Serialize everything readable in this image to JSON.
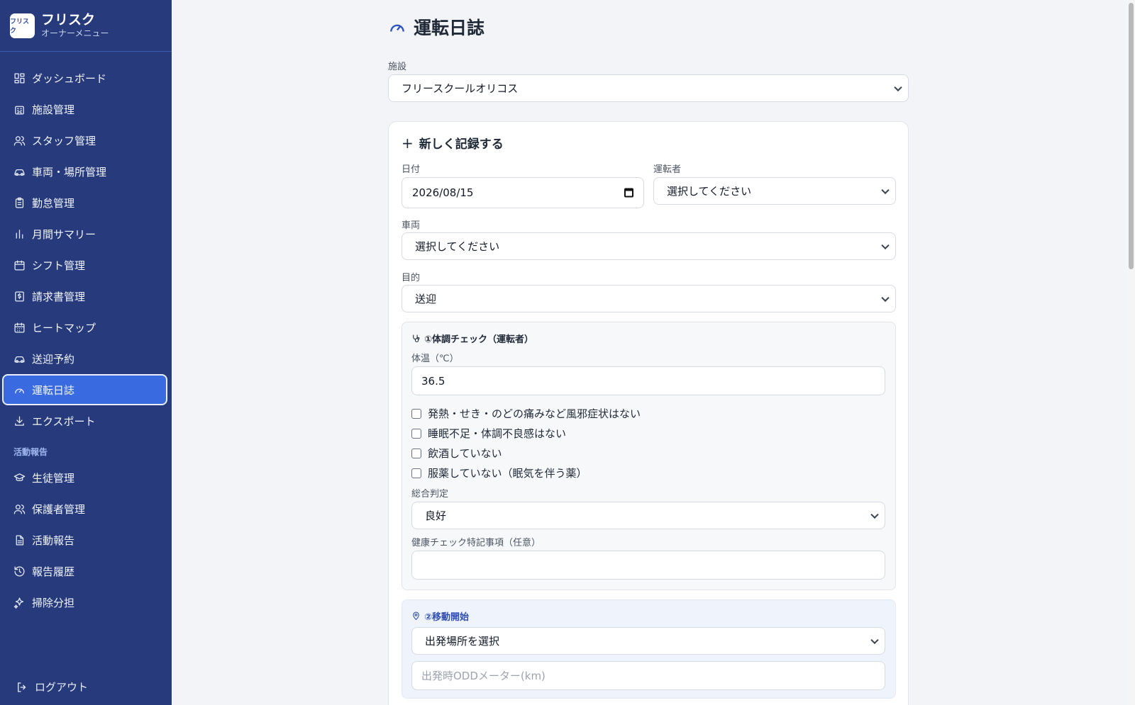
{
  "sidebar": {
    "brand": {
      "logo_text": "フリスク",
      "title": "フリスク",
      "subtitle": "オーナーメニュー"
    },
    "items": [
      {
        "label": "ダッシュボード",
        "icon": "dashboard-icon"
      },
      {
        "label": "施設管理",
        "icon": "building-icon"
      },
      {
        "label": "スタッフ管理",
        "icon": "users-icon"
      },
      {
        "label": "車両・場所管理",
        "icon": "car-icon"
      },
      {
        "label": "勤怠管理",
        "icon": "clipboard-icon"
      },
      {
        "label": "月間サマリー",
        "icon": "bar-chart-icon"
      },
      {
        "label": "シフト管理",
        "icon": "calendar-icon"
      },
      {
        "label": "請求書管理",
        "icon": "invoice-icon"
      },
      {
        "label": "ヒートマップ",
        "icon": "calendar-grid-icon"
      },
      {
        "label": "送迎予約",
        "icon": "car-icon"
      },
      {
        "label": "運転日誌",
        "icon": "gauge-icon",
        "active": true
      },
      {
        "label": "エクスポート",
        "icon": "download-icon"
      }
    ],
    "section_label": "活動報告",
    "section_items": [
      {
        "label": "生徒管理",
        "icon": "graduation-cap-icon"
      },
      {
        "label": "保護者管理",
        "icon": "users-icon"
      },
      {
        "label": "活動報告",
        "icon": "document-icon"
      },
      {
        "label": "報告履歴",
        "icon": "history-icon"
      },
      {
        "label": "掃除分担",
        "icon": "sparkles-icon"
      }
    ],
    "logout_label": "ログアウト"
  },
  "main": {
    "title": "運転日誌",
    "facility_label": "施設",
    "facility_value": "フリースクールオリコス",
    "form": {
      "title": "新しく記録する",
      "date_label": "日付",
      "date_value": "2026/08/15",
      "driver_label": "運転者",
      "driver_value": "選択してください",
      "vehicle_label": "車両",
      "vehicle_value": "選択してください",
      "purpose_label": "目的",
      "purpose_value": "送迎",
      "health": {
        "title": "①体調チェック（運転者）",
        "temp_label": "体温（℃）",
        "temp_value": "36.5",
        "checks": [
          "発熱・せき・のどの痛みなど風邪症状はない",
          "睡眠不足・体調不良感はない",
          "飲酒していない",
          "服薬していない（眠気を伴う薬）"
        ],
        "overall_label": "総合判定",
        "overall_value": "良好",
        "notes_label": "健康チェック特記事項（任意）",
        "notes_value": ""
      },
      "departure": {
        "title": "②移動開始",
        "place_value": "出発場所を選択",
        "odometer_placeholder": "出発時ODDメーター(km)"
      }
    }
  },
  "colors": {
    "sidebar_bg": "#263a7c",
    "active_bg": "#3a6ae0",
    "accent": "#2f55c4"
  }
}
